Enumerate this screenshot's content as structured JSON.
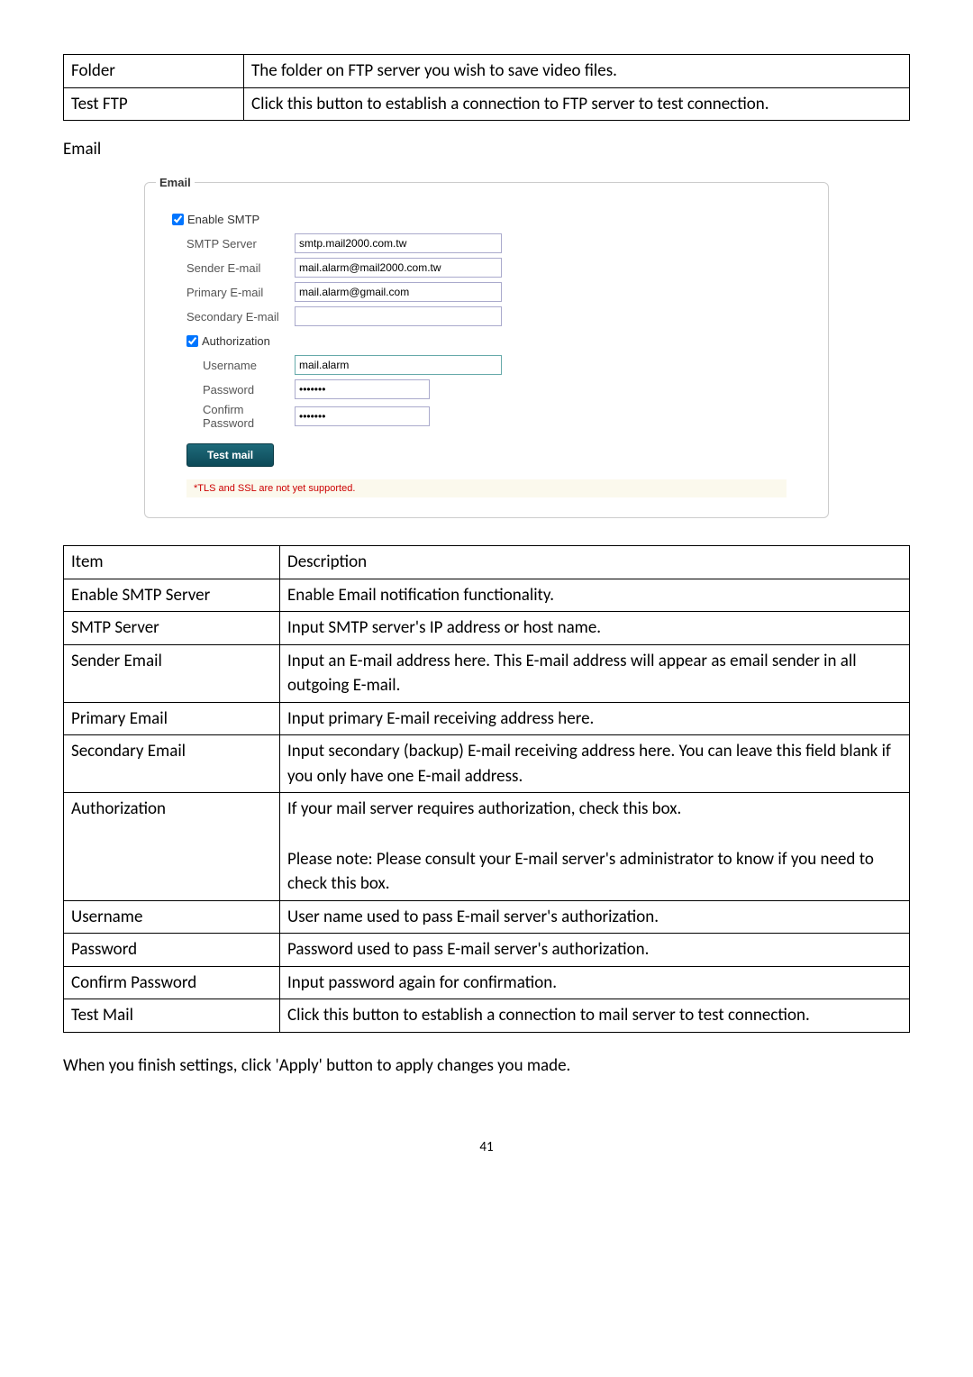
{
  "top_table": {
    "rows": [
      {
        "c0": "Folder",
        "c1": "The folder on FTP server you wish to save video files."
      },
      {
        "c0": "Test FTP",
        "c1": "Click this button to establish a connection to FTP server to test connection."
      }
    ]
  },
  "section_heading": "Email",
  "screenshot": {
    "legend": "Email",
    "enable_smtp_label": "Enable SMTP",
    "smtp_server_label": "SMTP Server",
    "smtp_server_value": "smtp.mail2000.com.tw",
    "sender_label": "Sender E-mail",
    "sender_value": "mail.alarm@mail2000.com.tw",
    "primary_label": "Primary E-mail",
    "primary_value": "mail.alarm@gmail.com",
    "secondary_label": "Secondary E-mail",
    "secondary_value": "",
    "authorization_label": "Authorization",
    "username_label": "Username",
    "username_value": "mail.alarm",
    "password_label": "Password",
    "password_value": "•••••••",
    "confirm_label": "Confirm Password",
    "confirm_value": "•••••••",
    "test_button": "Test mail",
    "note": "*TLS and SSL are not yet supported."
  },
  "desc_table": {
    "header": {
      "c0": "Item",
      "c1": "Description"
    },
    "rows": [
      {
        "c0": "Enable SMTP Server",
        "c1": "Enable Email notification functionality."
      },
      {
        "c0": "SMTP Server",
        "c1": "Input SMTP server's IP address or host name."
      },
      {
        "c0": "Sender Email",
        "c1": "Input an E-mail address here. This E-mail address will appear as email sender in all outgoing E-mail."
      },
      {
        "c0": "Primary Email",
        "c1": "Input primary E-mail receiving address here."
      },
      {
        "c0": "Secondary Email",
        "c1": "Input secondary (backup) E-mail receiving address here. You can leave this field blank if you only have one E-mail address."
      },
      {
        "c0": "Authorization",
        "c1": "If your mail server requires authorization, check this box.\n\nPlease note: Please consult your E-mail server's administrator to know if you need to check this box."
      },
      {
        "c0": "Username",
        "c1": "User name used to pass E-mail server's authorization."
      },
      {
        "c0": "Password",
        "c1": "Password used to pass E-mail server's authorization."
      },
      {
        "c0": "Confirm Password",
        "c1": "Input password again for confirmation."
      },
      {
        "c0": "Test Mail",
        "c1": "Click this button to establish a connection to mail server to test connection."
      }
    ]
  },
  "closing": "When you finish settings, click 'Apply' button to apply changes you made.",
  "page_number": "41"
}
